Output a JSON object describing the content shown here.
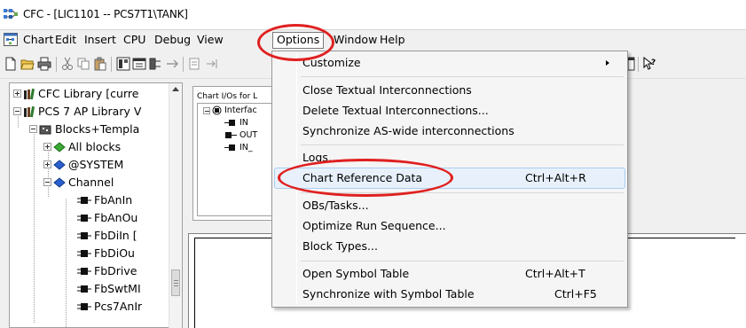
{
  "window": {
    "title": "CFC - [LIC1101 -- PCS7T1\\TANK]"
  },
  "menubar": {
    "items": [
      "Chart",
      "Edit",
      "Insert",
      "CPU",
      "Debug",
      "View",
      "Options",
      "Window",
      "Help"
    ],
    "active": "Options"
  },
  "tree": {
    "rows": [
      "CFC Library [curre",
      "PCS 7 AP Library V",
      "Blocks+Templa",
      "All blocks",
      "@SYSTEM",
      "Channel",
      "FbAnIn",
      "FbAnOu",
      "FbDiIn [",
      "FbDiOu",
      "FbDrive",
      "FbSwtMI",
      "Pcs7AnIr"
    ]
  },
  "io_panel": {
    "header": "Chart I/Os for L",
    "root": "Interfac",
    "children": [
      "IN",
      "OUT",
      "IN_"
    ]
  },
  "options_menu": {
    "items": [
      {
        "label": "Customize",
        "shortcut": "",
        "submenu": true
      },
      {
        "label": "Close Textual Interconnections",
        "shortcut": ""
      },
      {
        "label": "Delete Textual Interconnections...",
        "shortcut": ""
      },
      {
        "label": "Synchronize AS-wide interconnections",
        "shortcut": ""
      },
      {
        "label": "Logs...",
        "shortcut": ""
      },
      {
        "label": "Chart Reference Data",
        "shortcut": "Ctrl+Alt+R",
        "highlighted": true
      },
      {
        "label": "OBs/Tasks...",
        "shortcut": ""
      },
      {
        "label": "Optimize Run Sequence...",
        "shortcut": ""
      },
      {
        "label": "Block Types...",
        "shortcut": ""
      },
      {
        "label": "Open Symbol Table",
        "shortcut": "Ctrl+Alt+T"
      },
      {
        "label": "Synchronize with Symbol Table",
        "shortcut": "Ctrl+F5"
      }
    ]
  },
  "colors": {
    "annotation": "#e02020",
    "highlight_bg": "#e8f1fb",
    "highlight_border": "#a9cdf2"
  }
}
